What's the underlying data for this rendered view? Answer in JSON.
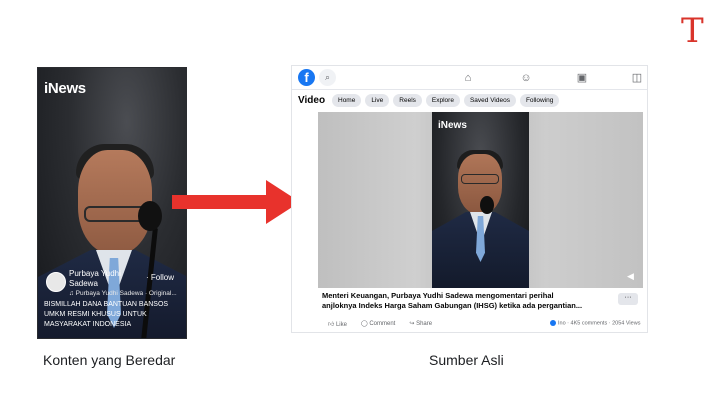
{
  "logo": {
    "letter": "T",
    "color": "#d9342b"
  },
  "left_panel": {
    "brand": "iNews",
    "username_line1": "Purbaya Yudhi",
    "username_line2": "Sadewa",
    "follow_label": "· Follow",
    "music_text": "♫ Purbaya Yudhi Sadewa · Original...",
    "caption": "BISMILLAH DANA BANTUAN BANSOS UMKM RESMI KHUSUS UNTUK MASYARAKAT INDONESIA",
    "label": "Konten yang Beredar"
  },
  "arrow": {
    "color": "#e8322c"
  },
  "right_panel": {
    "logo_letter": "f",
    "section_title": "Video",
    "tabs": [
      "Home",
      "Live",
      "Reels",
      "Explore",
      "Saved Videos",
      "Following"
    ],
    "video_brand": "iNews",
    "post_title_line1": "Menteri Keuangan, Purbaya Yudhi Sadewa mengomentari perihal",
    "post_title_line2": "anjloknya Indeks Harga Saham Gabungan (IHSG) ketika ada pergantian...",
    "more_label": "···",
    "actions": {
      "like": "Like",
      "comment": "Comment",
      "share": "Share"
    },
    "stats": "Ino · 4K5 comments · 2054 Views",
    "label": "Sumber Asli",
    "accent": "#1877f2"
  }
}
